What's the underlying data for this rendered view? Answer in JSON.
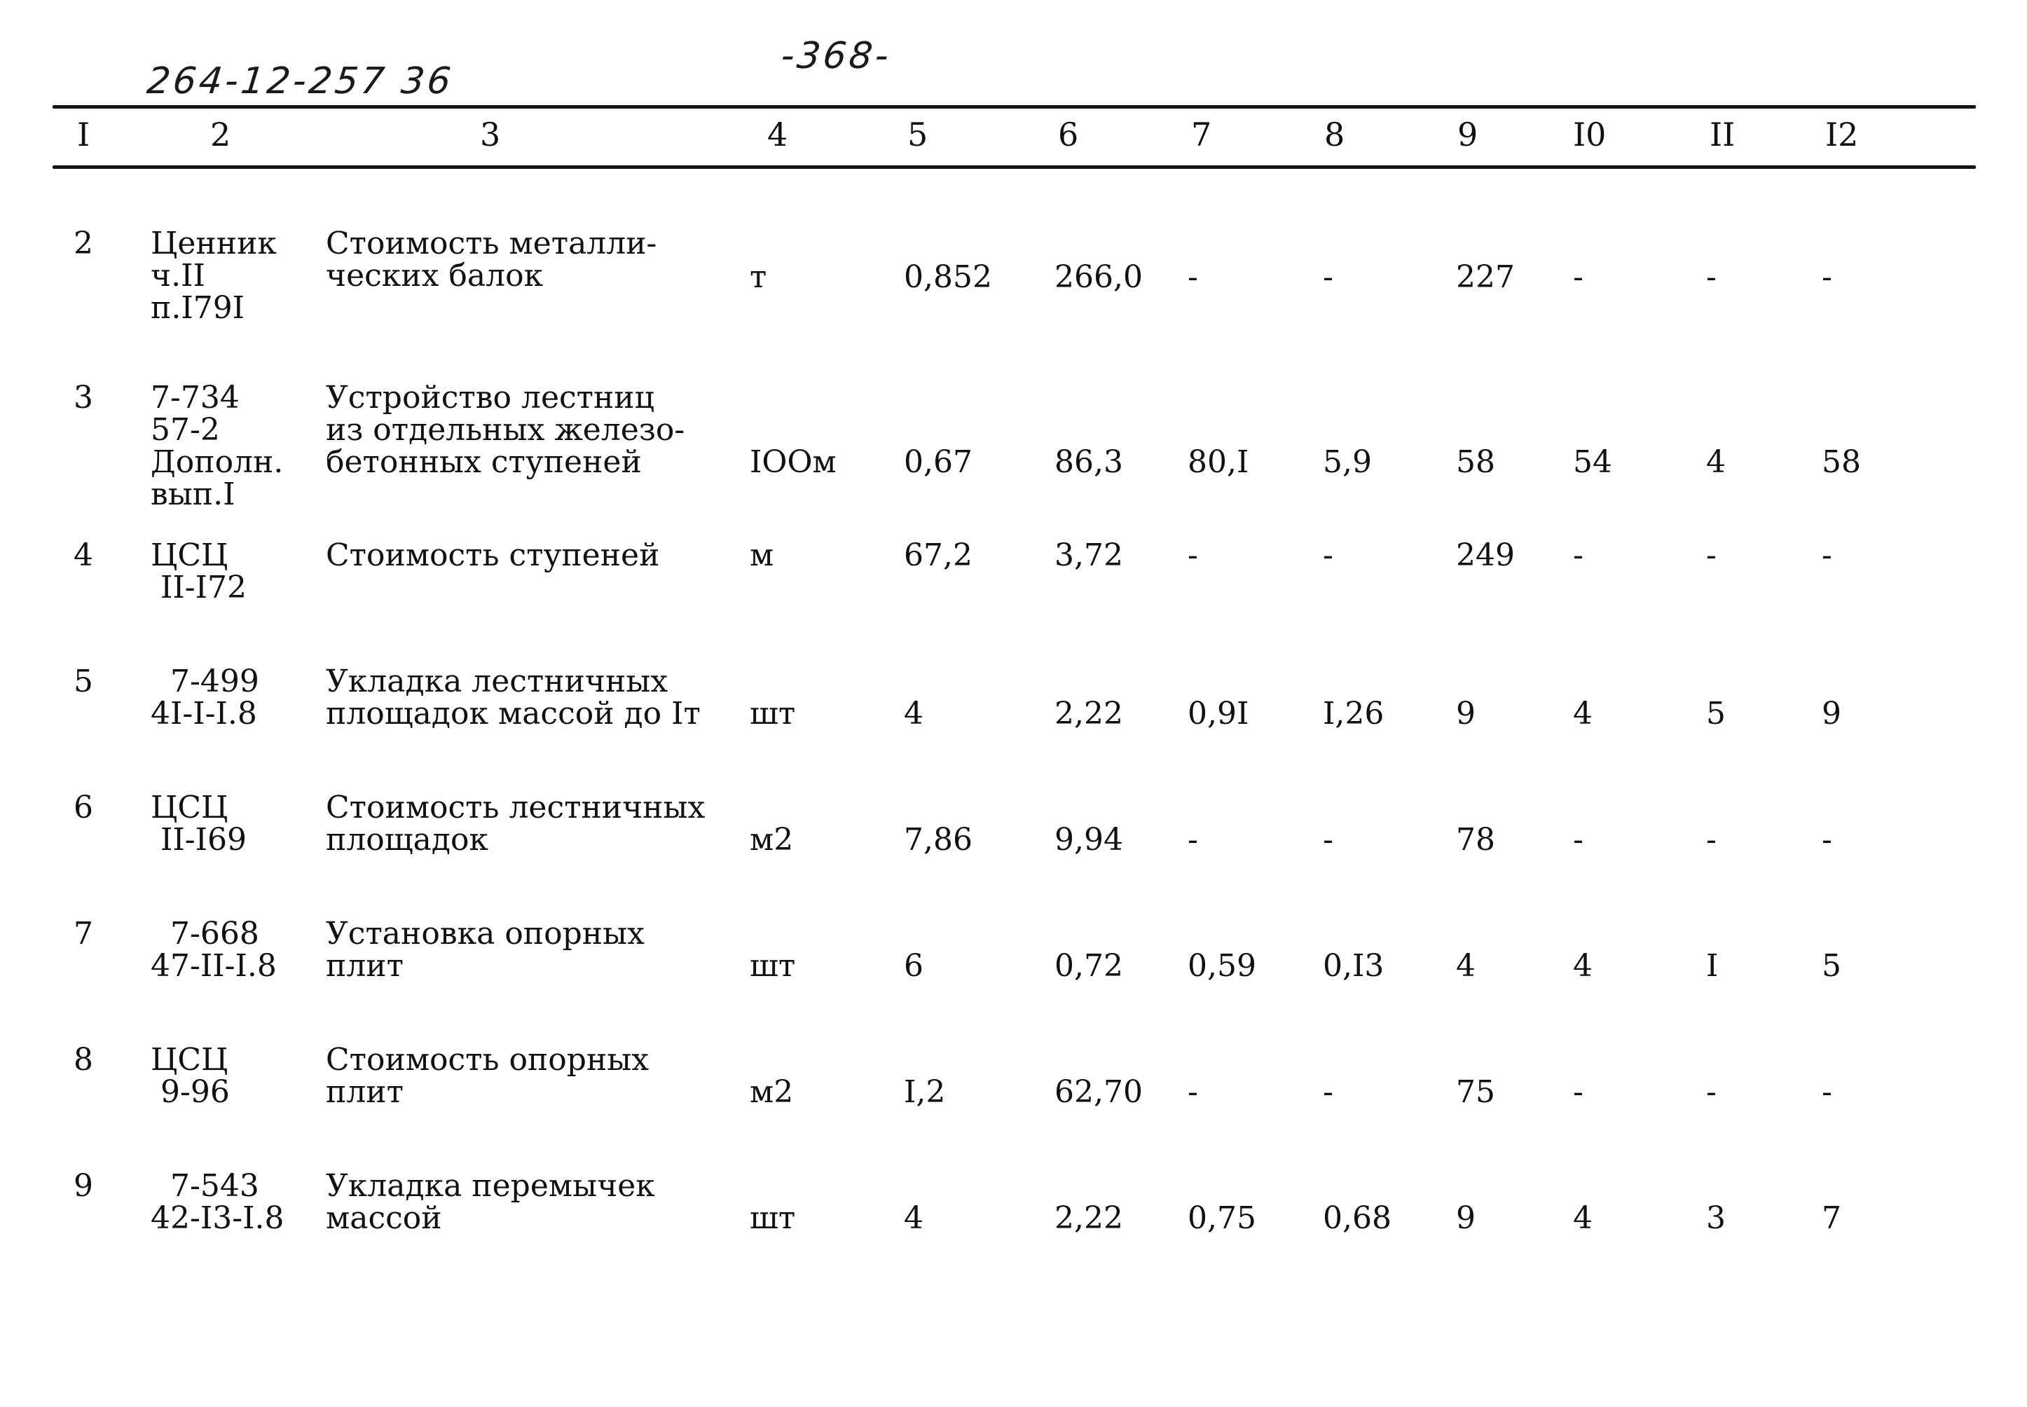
{
  "document": {
    "handwritten_code": "264-12-257 36",
    "page_number": "-368-"
  },
  "table": {
    "column_headers": [
      "I",
      "2",
      "3",
      "4",
      "5",
      "6",
      "7",
      "8",
      "9",
      "I0",
      "II",
      "I2"
    ],
    "rows": [
      {
        "no": "2",
        "code": "Ценник\nч.II\nп.I79I",
        "name": "Стоимость металли-\nческих балок",
        "unit": "т",
        "c5": "0,852",
        "c6": "266,0",
        "c7": "-",
        "c8": "-",
        "c9": "227",
        "c10": "-",
        "c11": "-",
        "c12": "-"
      },
      {
        "no": "3",
        "code": "7-734\n57-2\nДополн.\nвып.I",
        "name": "Устройство лестниц\nиз отдельных железо-\nбетонных ступеней",
        "unit": "IOOм",
        "c5": "0,67",
        "c6": "86,3",
        "c7": "80,I",
        "c8": "5,9",
        "c9": "58",
        "c10": "54",
        "c11": "4",
        "c12": "58"
      },
      {
        "no": "4",
        "code": "ЦСЦ\n II-I72",
        "name": "Стоимость ступеней",
        "unit": "м",
        "c5": "67,2",
        "c6": "3,72",
        "c7": "-",
        "c8": "-",
        "c9": "249",
        "c10": "-",
        "c11": "-",
        "c12": "-"
      },
      {
        "no": "5",
        "code": "  7-499\n4I-I-I.8",
        "name": "Укладка лестничных\nплощадок массой до Iт",
        "unit": "шт",
        "c5": "4",
        "c6": "2,22",
        "c7": "0,9I",
        "c8": "I,26",
        "c9": "9",
        "c10": "4",
        "c11": "5",
        "c12": "9"
      },
      {
        "no": "6",
        "code": "ЦСЦ\n II-I69",
        "name": "Стоимость лестничных\nплощадок",
        "unit": "м2",
        "c5": "7,86",
        "c6": "9,94",
        "c7": "-",
        "c8": "-",
        "c9": "78",
        "c10": "-",
        "c11": "-",
        "c12": "-"
      },
      {
        "no": "7",
        "code": "  7-668\n47-II-I.8",
        "name": "Установка опорных\nплит",
        "unit": "шт",
        "c5": "6",
        "c6": "0,72",
        "c7": "0,59",
        "c8": "0,I3",
        "c9": "4",
        "c10": "4",
        "c11": "I",
        "c12": "5"
      },
      {
        "no": "8",
        "code": "ЦСЦ\n 9-96",
        "name": "Стоимость опорных\nплит",
        "unit": "м2",
        "c5": "I,2",
        "c6": "62,70",
        "c7": "-",
        "c8": "-",
        "c9": "75",
        "c10": "-",
        "c11": "-",
        "c12": "-"
      },
      {
        "no": "9",
        "code": "  7-543\n42-I3-I.8",
        "name": "Укладка перемычек\nмассой",
        "unit": "шт",
        "c5": "4",
        "c6": "2,22",
        "c7": "0,75",
        "c8": "0,68",
        "c9": "9",
        "c10": "4",
        "c11": "3",
        "c12": "7"
      }
    ]
  }
}
